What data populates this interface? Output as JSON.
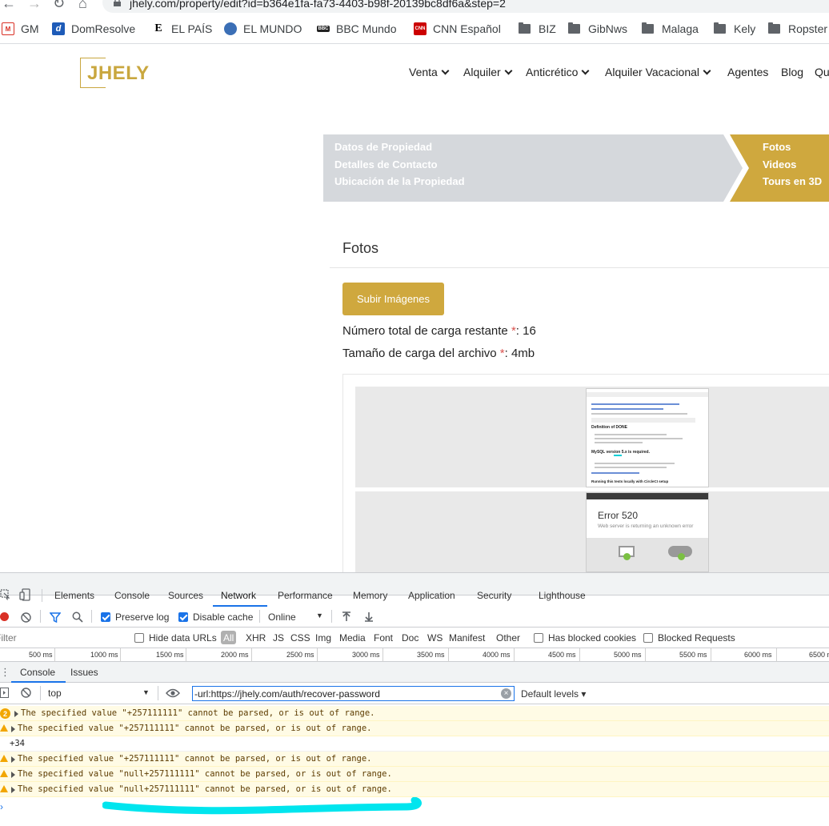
{
  "browser": {
    "url": "jhely.com/property/edit?id=b364e1fa-fa73-4403-b98f-20139bc8df6a&step=2",
    "bookmarks": [
      {
        "label": "GM",
        "icon": "gmail-icon"
      },
      {
        "label": "DomResolve",
        "icon": "domresolve-icon"
      },
      {
        "label": "EL PAÍS",
        "icon": "elpais-icon"
      },
      {
        "label": "EL MUNDO",
        "icon": "globe-icon"
      },
      {
        "label": "BBC Mundo",
        "icon": "bbc-icon"
      },
      {
        "label": "CNN Español",
        "icon": "cnn-icon"
      },
      {
        "label": "BIZ",
        "icon": "folder-icon"
      },
      {
        "label": "GibNws",
        "icon": "folder-icon"
      },
      {
        "label": "Malaga",
        "icon": "folder-icon"
      },
      {
        "label": "Kely",
        "icon": "folder-icon"
      },
      {
        "label": "Ropster",
        "icon": "folder-icon"
      }
    ]
  },
  "site": {
    "logo": "JHELY",
    "menu": [
      "Venta",
      "Alquiler",
      "Anticrético",
      "Alquiler Vacacional",
      "Agentes",
      "Blog",
      "Qu"
    ],
    "steps_left": [
      "Datos de Propiedad",
      "Detalles de Contacto",
      "Ubicación de la Propiedad"
    ],
    "steps_right": [
      "Fotos",
      "Videos",
      "Tours en 3D"
    ],
    "section_title": "Fotos",
    "upload_button": "Subir Imágenes",
    "remaining_label": "Número total de carga restante ",
    "remaining_value": ": 16",
    "size_label": "Tamaño de carga del archivo ",
    "size_value": ": 4mb",
    "required_mark": "*",
    "thumb2_error": "Error 520",
    "thumb2_sub": "Web server is returning an unknown error",
    "thumb1_heading1": "Definition of DONE",
    "thumb1_heading2": "MySQL version 5.x is required.",
    "thumb1_heading3": "Running this tests locally with CircleCI setup"
  },
  "devtools": {
    "tabs": [
      "Elements",
      "Console",
      "Sources",
      "Network",
      "Performance",
      "Memory",
      "Application",
      "Security",
      "Lighthouse"
    ],
    "active_tab": "Network",
    "network_toolbar": {
      "preserve_log": "Preserve log",
      "disable_cache": "Disable cache",
      "throttle": "Online"
    },
    "filter_row": {
      "filter_placeholder": "Filter",
      "hide_data_urls": "Hide data URLs",
      "types": [
        "All",
        "XHR",
        "JS",
        "CSS",
        "Img",
        "Media",
        "Font",
        "Doc",
        "WS",
        "Manifest",
        "Other"
      ],
      "has_blocked_cookies": "Has blocked cookies",
      "blocked_requests": "Blocked Requests"
    },
    "timeline_ticks": [
      "500 ms",
      "1000 ms",
      "1500 ms",
      "2000 ms",
      "2500 ms",
      "3000 ms",
      "3500 ms",
      "4000 ms",
      "4500 ms",
      "5000 ms",
      "5500 ms",
      "6000 ms",
      "6500 m"
    ],
    "drawer_tabs": [
      "Console",
      "Issues"
    ],
    "console": {
      "context": "top",
      "filter_value": "-url:https://jhely.com/auth/recover-password",
      "levels": "Default levels ▾",
      "messages": [
        {
          "type": "warn",
          "badge": "2",
          "text": "The specified value \"+257111111\" cannot be parsed, or is out of range."
        },
        {
          "type": "warn",
          "badge": "",
          "text": "The specified value \"+257111111\" cannot be parsed, or is out of range."
        },
        {
          "type": "log",
          "badge": "",
          "text": "+34"
        },
        {
          "type": "warn",
          "badge": "",
          "text": "The specified value \"+257111111\" cannot be parsed, or is out of range."
        },
        {
          "type": "warn",
          "badge": "",
          "text": "The specified value \"null+257111111\" cannot be parsed, or is out of range."
        },
        {
          "type": "warn",
          "badge": "",
          "text": "The specified value \"null+257111111\" cannot be parsed, or is out of range."
        }
      ]
    }
  },
  "colors": {
    "gold": "#cfa83e",
    "steps_grey": "#d5d8dc",
    "highlight": "#00e5ee",
    "devtools_accent": "#1a73e8"
  }
}
